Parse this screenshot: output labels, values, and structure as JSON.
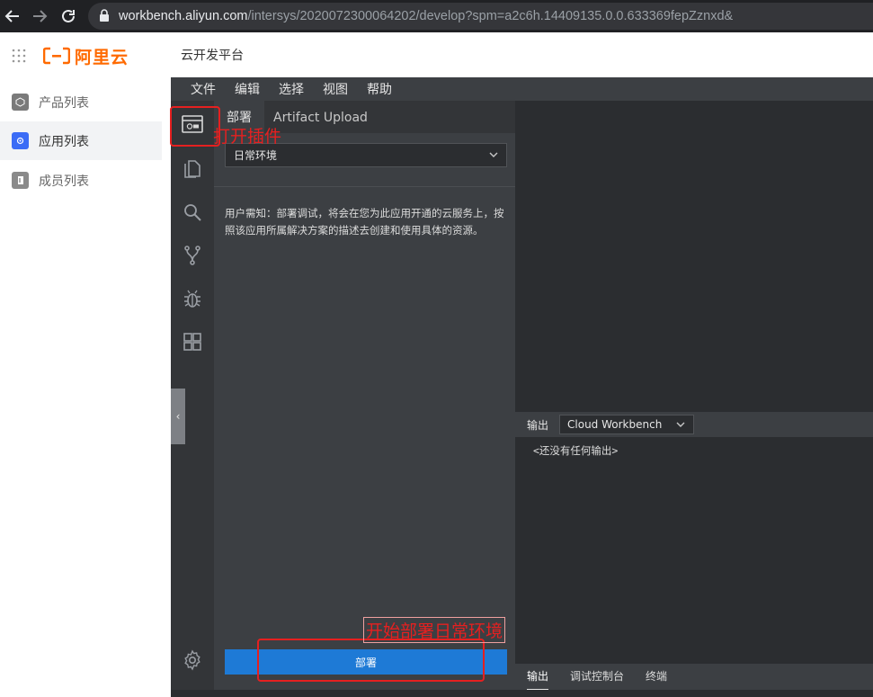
{
  "browser": {
    "url_host": "workbench.aliyun.com",
    "url_path": "/intersys/2020072300064202/develop?spm=a2c6h.14409135.0.0.633369fepZznxd&"
  },
  "header": {
    "logo_text": "阿里云",
    "platform_title": "云开发平台"
  },
  "sidebar": {
    "items": [
      {
        "label": "产品列表",
        "icon": "cube-icon",
        "color": "#7a7a7a"
      },
      {
        "label": "应用列表",
        "icon": "app-icon",
        "color": "#3b6cf6",
        "active": true
      },
      {
        "label": "成员列表",
        "icon": "member-icon",
        "color": "#8a8a8a"
      }
    ]
  },
  "ide": {
    "menu": [
      "文件",
      "编辑",
      "选择",
      "视图",
      "帮助"
    ],
    "panel_tabs": [
      "部署",
      "Artifact Upload"
    ],
    "env_select": "日常环境",
    "notice": "用户需知：部署调试，将会在您为此应用开通的云服务上，按照该应用所属解决方案的描述去创建和使用具体的资源。",
    "deploy_button": "部署",
    "output": {
      "title": "输出",
      "channel": "Cloud Workbench",
      "empty": "<还没有任何输出>"
    },
    "bottom_tabs": [
      "输出",
      "调试控制台",
      "终端"
    ]
  },
  "annotations": {
    "open_plugin": "打开插件",
    "start_deploy": "开始部署日常环境"
  },
  "colors": {
    "accent": "#1e7ad6",
    "brand": "#ff6a00",
    "annotation": "#e52020"
  }
}
